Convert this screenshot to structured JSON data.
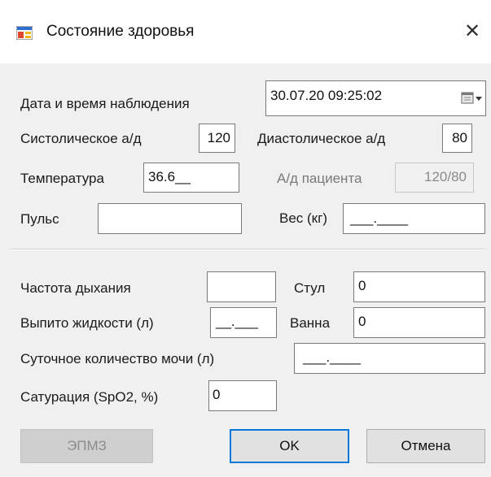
{
  "window": {
    "title": "Состояние здоровья",
    "close_glyph": "✕"
  },
  "observation": {
    "label": "Дата и время наблюдения",
    "datetime": "30.07.20 09:25:02"
  },
  "vitals": {
    "systolic_label": "Систолическое а/д",
    "systolic_value": "120",
    "diastolic_label": "Диастолическое а/д",
    "diastolic_value": "80",
    "temperature_label": "Температура",
    "temperature_value": "36.6__",
    "patient_bp_label": "А/д пациента",
    "patient_bp_value": "120/80",
    "pulse_label": "Пульс",
    "pulse_value": "",
    "weight_label": "Вес (кг)",
    "weight_value": "___.____"
  },
  "extra": {
    "respiration_label": "Частота дыхания",
    "respiration_value": "",
    "stool_label": "Стул",
    "stool_value": "0",
    "fluid_label": "Выпито жидкости (л)",
    "fluid_value": "__.___",
    "bath_label": "Ванна",
    "bath_value": "0",
    "urine_label": "Суточное количество мочи (л)",
    "urine_value": "___.____",
    "saturation_label": "Сатурация (SpO2, %)",
    "saturation_value": "0"
  },
  "buttons": {
    "epmz": "ЭПМЗ",
    "ok": "OK",
    "cancel": "Отмена"
  },
  "icons": {
    "app": "app-window-icon",
    "calendar": "calendar-dropdown-icon",
    "close": "close-icon"
  },
  "colors": {
    "focus_border": "#0078d7",
    "window_bg": "#f0f0f0",
    "titlebar_bg": "#ffffff"
  }
}
